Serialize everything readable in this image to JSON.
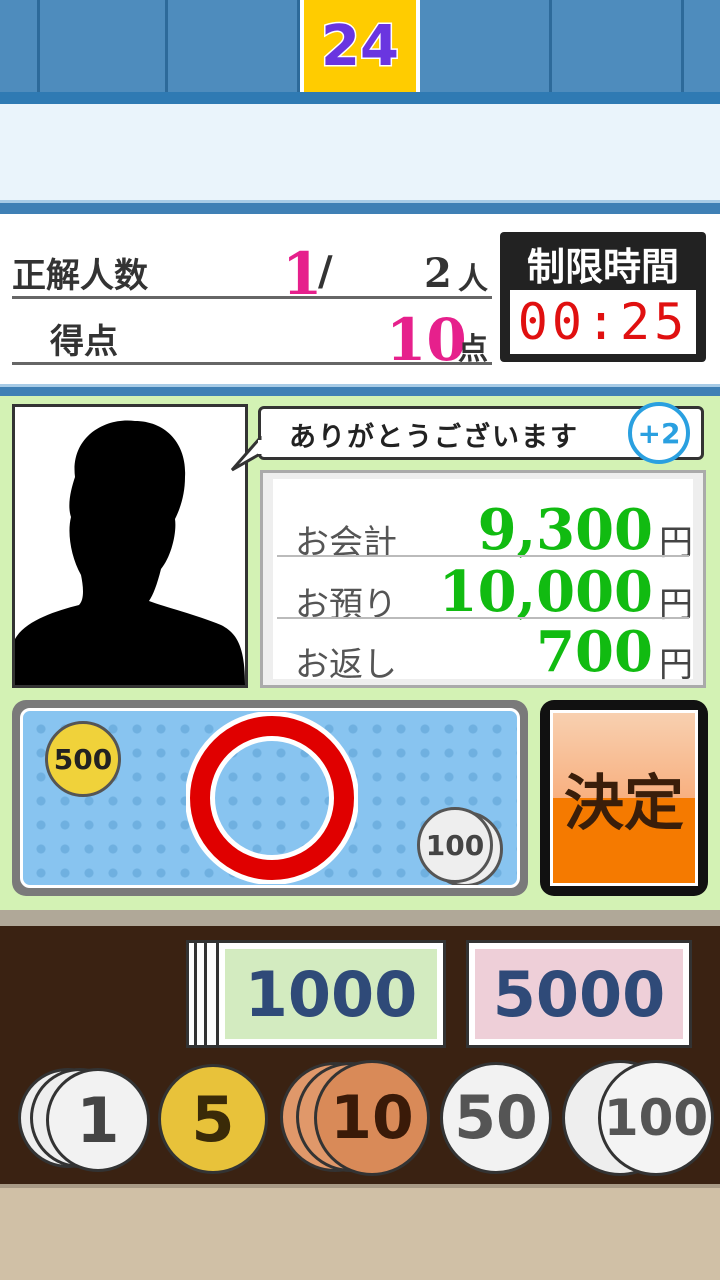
{
  "header": {
    "stage_number": "24"
  },
  "status": {
    "correct_label": "正解人数",
    "correct_count": "1",
    "slash": "/",
    "total_count": "2",
    "people_unit": "人",
    "score_label": "得点",
    "score_value": "10",
    "score_unit": "点",
    "timer_label": "制限時間",
    "timer_value": "00:25"
  },
  "customer": {
    "speech": "ありがとうございます",
    "bonus": "+2"
  },
  "receipt": {
    "rows": [
      {
        "label": "お会計",
        "value": "9,300",
        "unit": "円"
      },
      {
        "label": "お預り",
        "value": "10,000",
        "unit": "円"
      },
      {
        "label": "お返し",
        "value": "700",
        "unit": "円"
      }
    ]
  },
  "tray": {
    "coins": [
      "500",
      "100"
    ],
    "result_mark": "correct-circle"
  },
  "decide_button": {
    "label": "決定"
  },
  "wallet": {
    "notes": [
      "1000",
      "5000"
    ],
    "coins": [
      "1",
      "5",
      "10",
      "50",
      "100"
    ]
  },
  "colors": {
    "accent_blue": "#3f80b5",
    "money_green": "#11bb11",
    "highlight_pink": "#e6208c",
    "timer_red": "#e01010",
    "decide_orange": "#f57a00"
  }
}
